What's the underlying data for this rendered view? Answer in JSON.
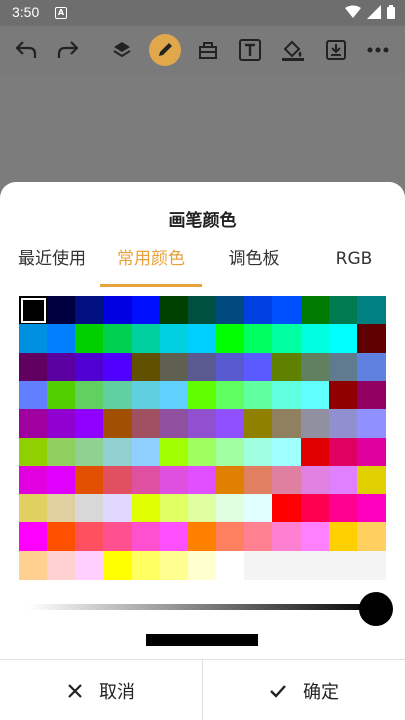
{
  "status_bar": {
    "time": "3:50",
    "notification_letter": "A"
  },
  "sheet": {
    "title": "画笔颜色",
    "tabs": [
      {
        "label": "最近使用",
        "active": false
      },
      {
        "label": "常用颜色",
        "active": true
      },
      {
        "label": "调色板",
        "active": false
      },
      {
        "label": "RGB",
        "active": false
      }
    ],
    "accent_color": "#e8a23b",
    "selected_color": "#000000",
    "brightness_slider_level": 1.0,
    "palette_rows": [
      [
        "#000000",
        "#000040",
        "#001080",
        "#0000e0",
        "#0010ff",
        "#004000",
        "#005040",
        "#004a80",
        "#0040e0",
        "#0050ff",
        "#007a00",
        "#007a50",
        "#008080"
      ],
      [
        "#0090e0",
        "#0080ff",
        "#00d000",
        "#00d050",
        "#00d0a0",
        "#00d0e0",
        "#00d0ff",
        "#00ff00",
        "#00ff60",
        "#00ffa0",
        "#00ffe0",
        "#00ffff",
        "#600000"
      ],
      [
        "#600060",
        "#5a00a0",
        "#5000d0",
        "#5000ff",
        "#605000",
        "#606050",
        "#5a5a90",
        "#5a5ad0",
        "#5a5aff",
        "#608000",
        "#608060",
        "#607a90",
        "#6080e0"
      ],
      [
        "#6080ff",
        "#50d000",
        "#60d060",
        "#60d0a0",
        "#60d0e0",
        "#60d0ff",
        "#60ff00",
        "#60ff60",
        "#60ffa0",
        "#60ffe0",
        "#60ffff",
        "#900000",
        "#900060"
      ],
      [
        "#a000a0",
        "#9000d0",
        "#9000ff",
        "#a05000",
        "#a05060",
        "#9050a0",
        "#9050d0",
        "#9050ff",
        "#908000",
        "#908060",
        "#9090a0",
        "#9090d0",
        "#9090ff"
      ],
      [
        "#90d000",
        "#90d060",
        "#90d090",
        "#90d0d0",
        "#90d0ff",
        "#a0ff00",
        "#a0ff60",
        "#a0ffa0",
        "#a0ffe0",
        "#a0ffff",
        "#e00000",
        "#e00060",
        "#e000a0"
      ],
      [
        "#e000e0",
        "#e000ff",
        "#e05000",
        "#e05060",
        "#e050a0",
        "#e050e0",
        "#e050ff",
        "#e08000",
        "#e08060",
        "#e080a0",
        "#e080e0",
        "#e080ff",
        "#e0d000"
      ],
      [
        "#e0d060",
        "#e0d0a0",
        "#d8d8d8",
        "#e0d8ff",
        "#e0ff00",
        "#e0ff60",
        "#e0ffa0",
        "#e0ffe0",
        "#e0ffff",
        "#ff0000",
        "#ff0050",
        "#ff0090",
        "#ff00c0"
      ],
      [
        "#ff00ff",
        "#ff5000",
        "#ff5060",
        "#ff5090",
        "#ff50d0",
        "#ff50ff",
        "#ff8000",
        "#ff8060",
        "#ff8090",
        "#ff80d0",
        "#ff80ff",
        "#ffd000",
        "#ffd060"
      ],
      [
        "#ffd090",
        "#ffd0d0",
        "#ffd0ff",
        "#ffff00",
        "#ffff60",
        "#ffff90",
        "#ffffd0",
        "#ffffff",
        "#f4f4f4",
        "#f4f4f4",
        "#f4f4f4",
        "#f4f4f4",
        "#f4f4f4"
      ]
    ]
  },
  "footer": {
    "cancel_label": "取消",
    "confirm_label": "确定"
  }
}
